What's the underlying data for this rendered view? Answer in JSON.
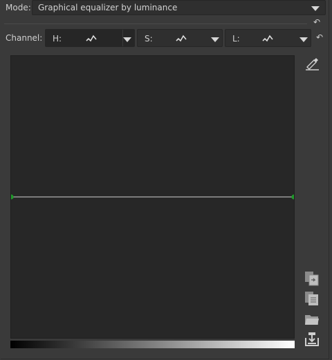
{
  "mode": {
    "label": "Mode:",
    "value": "Graphical equalizer by luminance"
  },
  "channel": {
    "label": "Channel:",
    "items": [
      {
        "label": "H:"
      },
      {
        "label": "S:"
      },
      {
        "label": "L:"
      }
    ]
  },
  "curve": {
    "type": "flat-line",
    "points": [
      [
        0,
        0.5
      ],
      [
        1,
        0.5
      ]
    ],
    "line_color": "#9a9a9a",
    "point_color": "#1f9b2a"
  },
  "icons": {
    "undo": "undo-icon",
    "picker": "color-picker-icon",
    "copy": "copy-icon",
    "paste": "paste-icon",
    "open": "folder-open-icon",
    "save": "save-icon"
  }
}
